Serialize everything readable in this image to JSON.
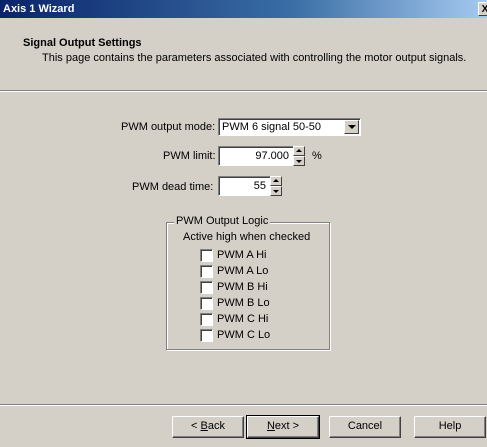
{
  "window": {
    "title": "Axis 1 Wizard",
    "close_glyph": "X"
  },
  "header": {
    "title": "Signal Output Settings",
    "description": "This page contains the parameters associated with controlling the motor output signals."
  },
  "pwm_output_mode": {
    "label": "PWM output mode:",
    "value": "PWM 6 signal 50-50"
  },
  "pwm_limit": {
    "label": "PWM limit:",
    "value": "97.000",
    "unit": "%"
  },
  "pwm_dead_time": {
    "label": "PWM dead time:",
    "value": "55"
  },
  "output_logic": {
    "group_label": "PWM Output Logic",
    "subtitle": "Active high when checked",
    "items": [
      {
        "label": "PWM A Hi",
        "checked": false
      },
      {
        "label": "PWM A Lo",
        "checked": false
      },
      {
        "label": "PWM B Hi",
        "checked": false
      },
      {
        "label": "PWM B Lo",
        "checked": false
      },
      {
        "label": "PWM C Hi",
        "checked": false
      },
      {
        "label": "PWM C Lo",
        "checked": false
      }
    ]
  },
  "buttons": {
    "back": {
      "prefix": "< ",
      "mnemonic": "B",
      "rest": "ack"
    },
    "next": {
      "mnemonic": "N",
      "rest": "ext >"
    },
    "cancel": "Cancel",
    "help": "Help"
  }
}
